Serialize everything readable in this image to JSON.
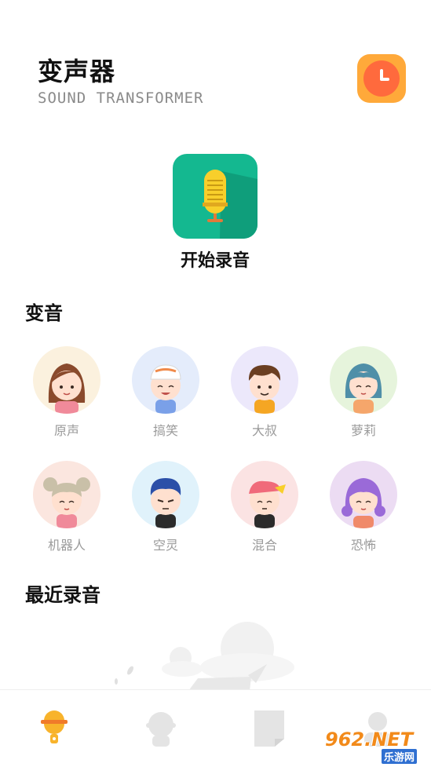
{
  "header": {
    "title": "变声器",
    "subtitle": "SOUND TRANSFORMER",
    "history_icon": "clock-icon"
  },
  "record": {
    "label": "开始录音",
    "icon": "microphone-icon"
  },
  "voice_section": {
    "title": "变音",
    "items": [
      {
        "label": "原声",
        "bg": "#fbf1de",
        "avatar": "girl-brown-hair-avatar"
      },
      {
        "label": "搞笑",
        "bg": "#e4ecfb",
        "avatar": "boy-cap-avatar"
      },
      {
        "label": "大叔",
        "bg": "#ece8fb",
        "avatar": "man-brown-hair-avatar"
      },
      {
        "label": "萝莉",
        "bg": "#e6f4dc",
        "avatar": "girl-teal-hair-avatar"
      },
      {
        "label": "机器人",
        "bg": "#fbe6df",
        "avatar": "girl-buns-avatar"
      },
      {
        "label": "空灵",
        "bg": "#e0f2fb",
        "avatar": "boy-blue-hair-avatar"
      },
      {
        "label": "混合",
        "bg": "#fbe3e3",
        "avatar": "bandana-avatar"
      },
      {
        "label": "恐怖",
        "bg": "#ecdcf3",
        "avatar": "girl-purple-hair-avatar"
      }
    ]
  },
  "recent_section": {
    "title": "最近录音",
    "empty_illustration": "empty-clouds-illustration"
  },
  "tabbar": {
    "tabs": [
      {
        "name": "record",
        "icon": "microphone-tab-icon",
        "active": true
      },
      {
        "name": "voice",
        "icon": "avatar-tab-icon",
        "active": false
      },
      {
        "name": "files",
        "icon": "document-tab-icon",
        "active": false
      },
      {
        "name": "me",
        "icon": "person-tab-icon",
        "active": false
      }
    ]
  },
  "watermark": {
    "main": "962.NET",
    "sub": "乐游网"
  },
  "colors": {
    "accent_orange": "#ffa93a",
    "record_green": "#14b890",
    "mic_yellow": "#f8cf2b",
    "inactive_gray": "#e4e4e4"
  }
}
